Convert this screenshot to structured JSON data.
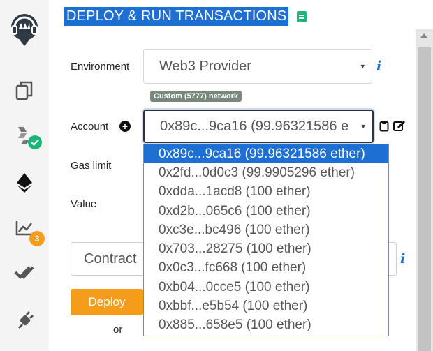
{
  "panel": {
    "title": "DEPLOY & RUN TRANSACTIONS"
  },
  "environment": {
    "label": "Environment",
    "value": "Web3 Provider",
    "network_badge": "Custom (5777) network"
  },
  "account": {
    "label": "Account",
    "value": "0x89c...9ca16 (99.96321586 e",
    "options": [
      "0x89c...9ca16 (99.96321586 ether)",
      "0x2fd...0d0c3 (99.9905296 ether)",
      "0xdda...1acd8 (100 ether)",
      "0xd2b...065c6 (100 ether)",
      "0xc3e...bc496 (100 ether)",
      "0x703...28275 (100 ether)",
      "0x0c3...fc668 (100 ether)",
      "0xb04...0cce5 (100 ether)",
      "0xbbf...e5b54 (100 ether)",
      "0x885...658e5 (100 ether)"
    ]
  },
  "gas_limit": {
    "label": "Gas limit"
  },
  "value": {
    "label": "Value"
  },
  "contract": {
    "placeholder": "Contract"
  },
  "deploy": {
    "label": "Deploy",
    "or": "or"
  },
  "sidebar": {
    "analysis_badge": "3"
  },
  "icons": {
    "info": "i",
    "plus": "+",
    "caret": "▾"
  },
  "colors": {
    "accent": "#1e6fd4",
    "deploy": "#f59c1a",
    "success": "#1bb57a",
    "badge_gray": "#77887c"
  }
}
